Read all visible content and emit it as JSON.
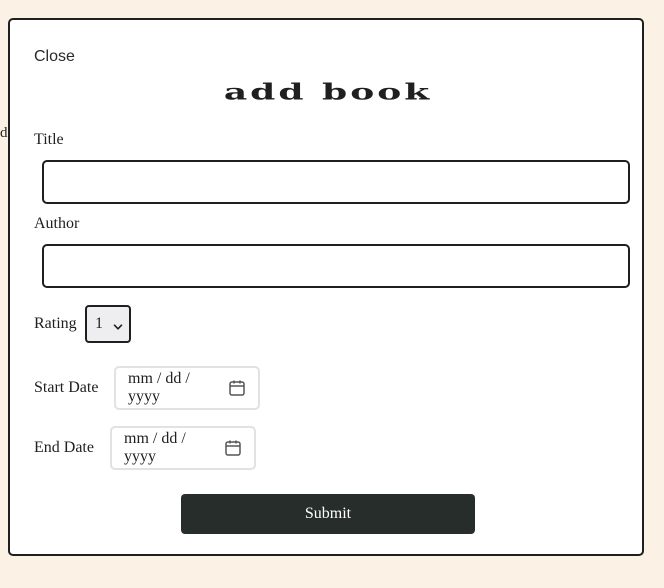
{
  "backdrop": {
    "partial_text": "d"
  },
  "modal": {
    "close_label": "Close",
    "title": "add book",
    "fields": {
      "title": {
        "label": "Title",
        "value": "",
        "placeholder": ""
      },
      "author": {
        "label": "Author",
        "value": "",
        "placeholder": ""
      },
      "rating": {
        "label": "Rating",
        "selected": "1",
        "icon": "chevron-down-icon"
      },
      "start_date": {
        "label": "Start Date",
        "placeholder": "mm / dd / yyyy",
        "icon": "calendar-icon"
      },
      "end_date": {
        "label": "End Date",
        "placeholder": "mm / dd / yyyy",
        "icon": "calendar-icon"
      }
    },
    "submit_label": "Submit"
  },
  "colors": {
    "page_background": "#fcf1e5",
    "modal_background": "#ffffff",
    "border": "#1f1f1f",
    "submit_background": "#262d2a",
    "submit_text": "#ffffff",
    "select_background": "#eeeef0",
    "date_border": "#e2e2e2"
  }
}
